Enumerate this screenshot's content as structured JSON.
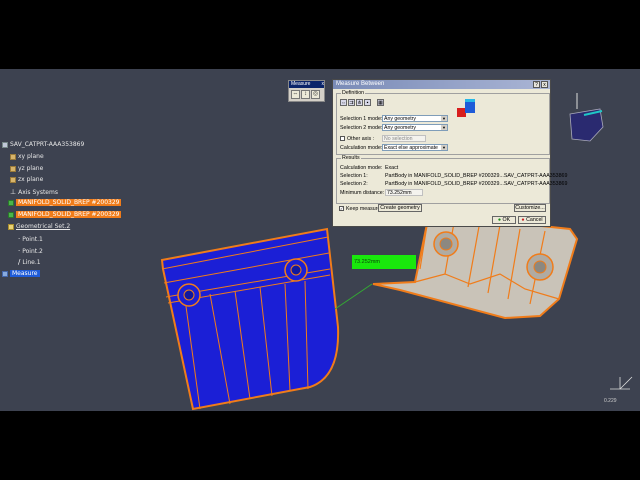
{
  "tree": {
    "root": "SAV_CATPRT-AAA353869",
    "planes": [
      "xy plane",
      "yz plane",
      "zx plane"
    ],
    "axis_systems": "Axis Systems",
    "bodies": [
      "MANIFOLD_SOLID_BREP #200329",
      "MANIFOLD_SOLID_BREP #200329"
    ],
    "geo_set": "Geometrical Set.2",
    "geo_items": [
      "Point.1",
      "Point.2",
      "Line.1"
    ],
    "measure": "Measure"
  },
  "measure_toolbar": {
    "title": "Measure",
    "close": "x"
  },
  "dialog": {
    "title": "Measure Between",
    "help_btn": "?",
    "close_btn": "x",
    "definition_legend": "Definition",
    "selection1_label": "Selection 1 mode:",
    "selection1_value": "Any geometry",
    "selection2_label": "Selection 2 mode:",
    "selection2_value": "Any geometry",
    "other_axis_label": "Other axis :",
    "other_axis_value": "No selection",
    "calc_mode_label": "Calculation mode:",
    "calc_mode_value": "Exact else approximate",
    "results_legend": "Results",
    "results": [
      {
        "label": "Calculation mode:",
        "value": "Exact"
      },
      {
        "label": "Selection 1:",
        "value": "PartBody in MANIFOLD_SOLID_BREP #200329...SAV_CATPRT-AAA353869"
      },
      {
        "label": "Selection 2:",
        "value": "PartBody in MANIFOLD_SOLID_BREP #200329...SAV_CATPRT-AAA353869"
      }
    ],
    "min_distance_label": "Minimum distance:",
    "min_distance_value": "73.252mm",
    "keep_measure_label": "Keep measure",
    "create_geometry_label": "Create geometry",
    "customize_label": "Customize...",
    "ok_label": "OK",
    "cancel_label": "Cancel"
  },
  "distance_annotation": "73.252mm",
  "scale_readout": "0.229",
  "colors": {
    "blue_part": "#1b1fd6",
    "tan_part": "#c9c3b8",
    "edge_orange": "#f07c1a",
    "highlight_orange": "#f07c1a",
    "annotation_green": "#19e80c",
    "viewport_bg": "#3d4250",
    "dialog_bg": "#ece9d8",
    "dialog_title": "#7a8bb7"
  }
}
